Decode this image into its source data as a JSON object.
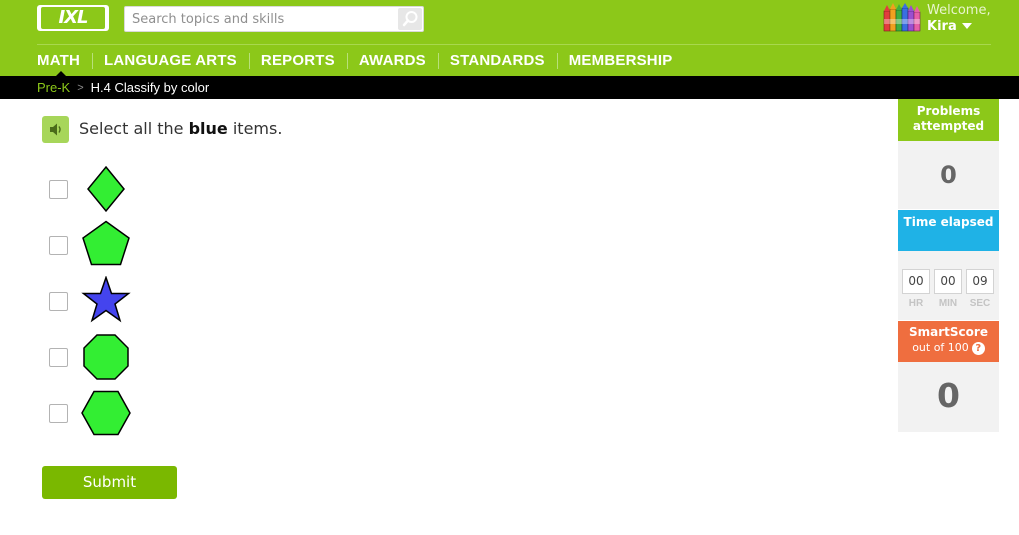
{
  "header": {
    "logo_text": "IXL",
    "search_placeholder": "Search topics and skills",
    "welcome_label": "Welcome,",
    "user_name": "Kira"
  },
  "nav": {
    "items": [
      {
        "label": "MATH",
        "active": true
      },
      {
        "label": "LANGUAGE ARTS",
        "active": false
      },
      {
        "label": "REPORTS",
        "active": false
      },
      {
        "label": "AWARDS",
        "active": false
      },
      {
        "label": "STANDARDS",
        "active": false
      },
      {
        "label": "MEMBERSHIP",
        "active": false
      }
    ]
  },
  "breadcrumb": {
    "grade": "Pre-K",
    "separator": ">",
    "skill": "H.4 Classify by color"
  },
  "question": {
    "prompt_prefix": "Select all the ",
    "prompt_bold": "blue",
    "prompt_suffix": " items.",
    "choices": [
      {
        "shape": "diamond",
        "color": "#33ee33",
        "checked": false
      },
      {
        "shape": "pentagon",
        "color": "#33ee33",
        "checked": false
      },
      {
        "shape": "star",
        "color": "#4444ee",
        "checked": false
      },
      {
        "shape": "octagon",
        "color": "#33ee33",
        "checked": false
      },
      {
        "shape": "hexagon",
        "color": "#33ee33",
        "checked": false
      }
    ],
    "submit_label": "Submit"
  },
  "stats": {
    "problems_label": "Problems attempted",
    "problems_value": "0",
    "time_label": "Time elapsed",
    "time": {
      "hr": "00",
      "min": "00",
      "sec": "09"
    },
    "time_units": {
      "hr": "HR",
      "min": "MIN",
      "sec": "SEC"
    },
    "smartscore_label": "SmartScore",
    "smartscore_sub": "out of 100",
    "help_glyph": "?",
    "smartscore_value": "0"
  },
  "colors": {
    "brand_green": "#8cc819",
    "time_blue": "#1fb2e6",
    "smartscore_orange": "#ef6e3f",
    "submit_green": "#7ab800"
  }
}
